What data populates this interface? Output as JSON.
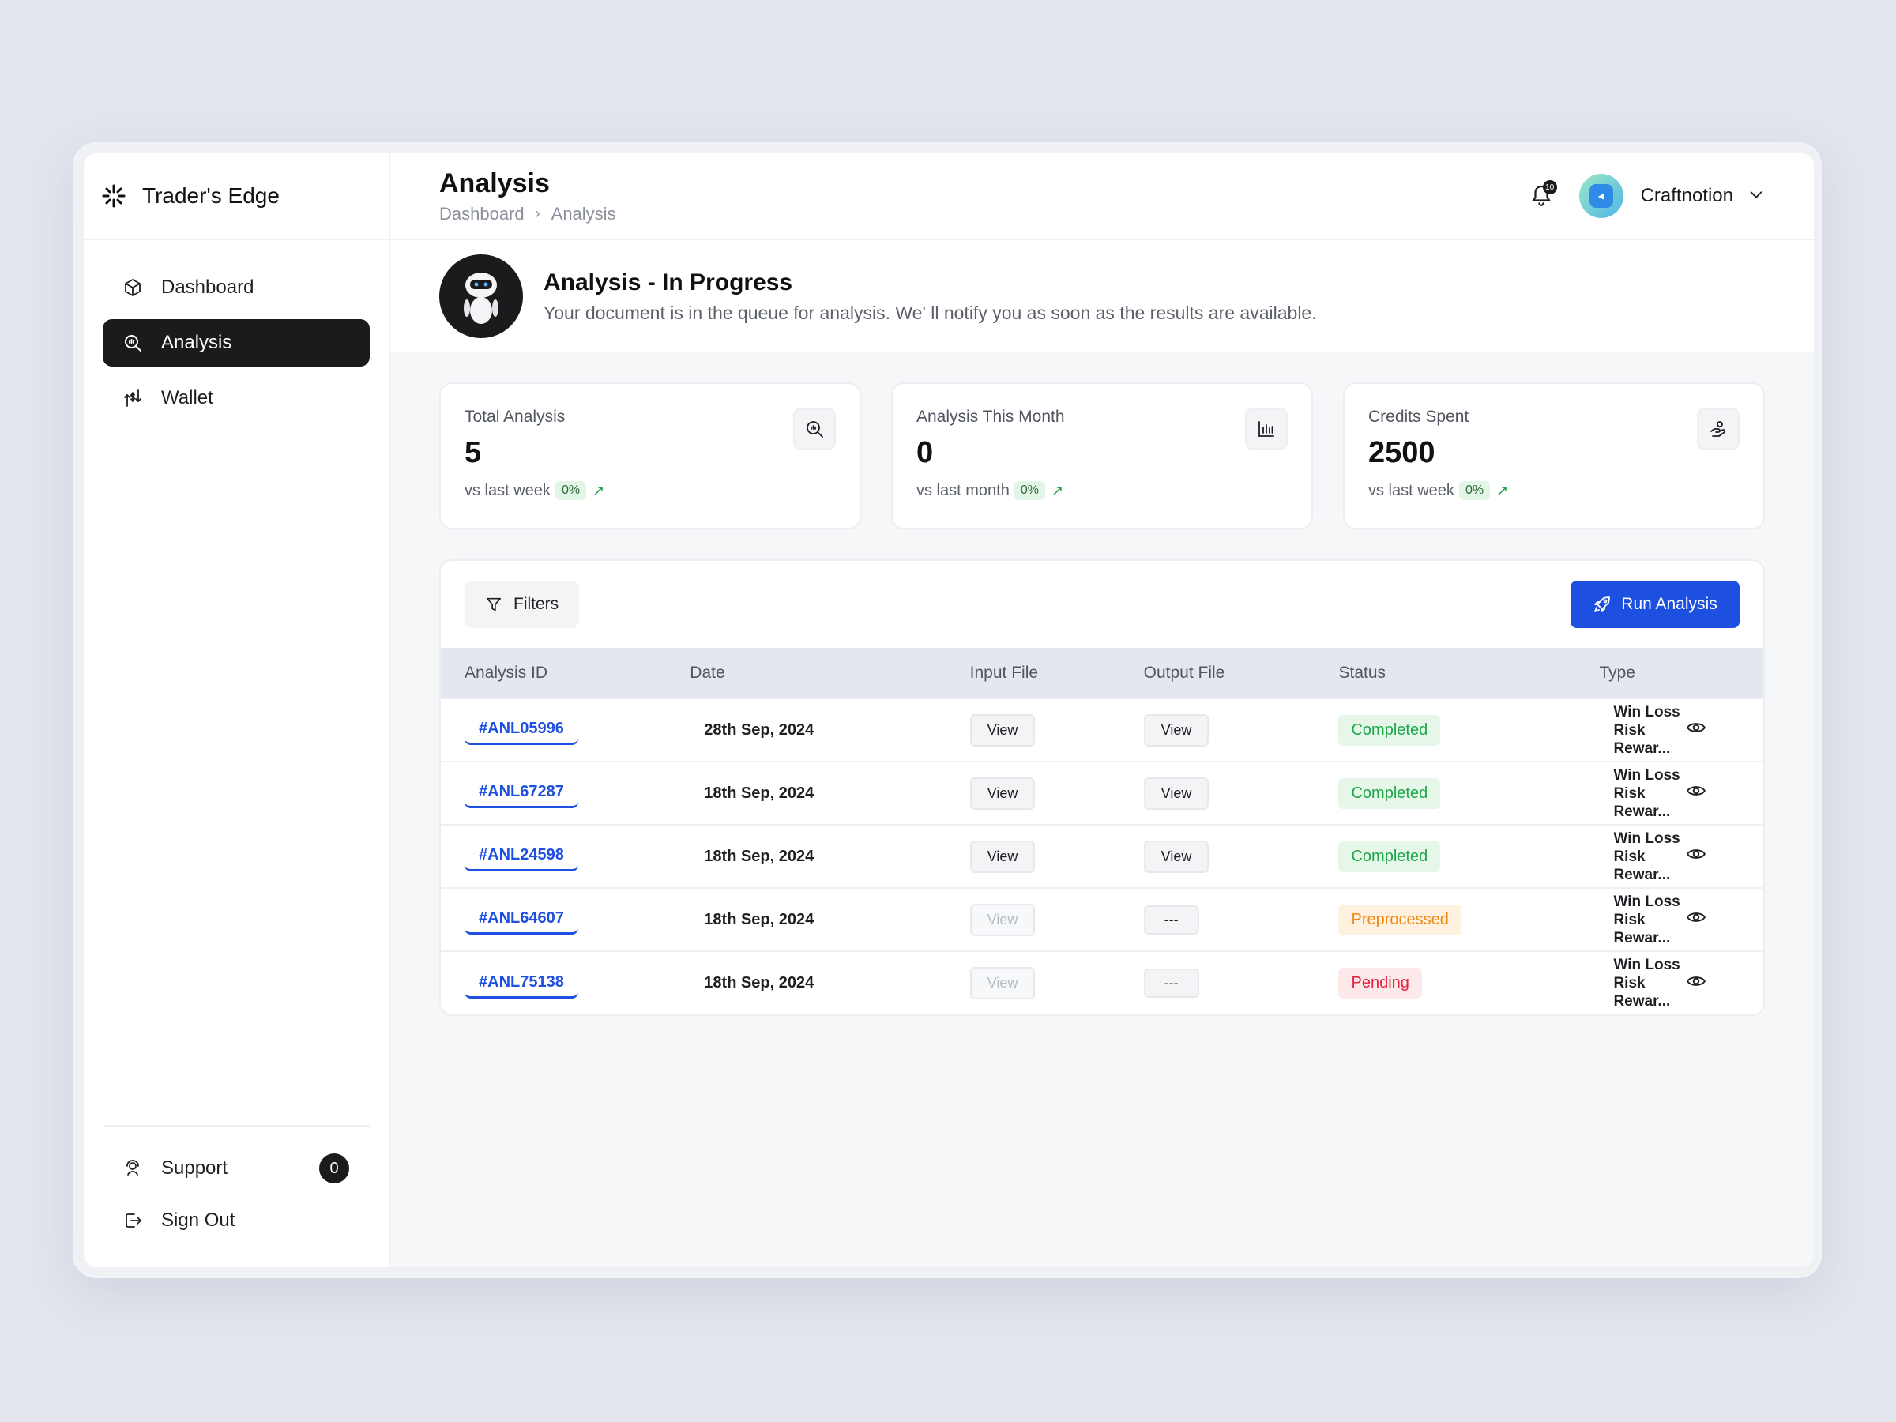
{
  "brand": {
    "name": "Trader's Edge",
    "icon": "sparkle-logo-icon"
  },
  "sidebar": {
    "items": [
      {
        "label": "Dashboard",
        "icon": "cube-icon",
        "active": false
      },
      {
        "label": "Analysis",
        "icon": "search-analysis-icon",
        "active": true
      },
      {
        "label": "Wallet",
        "icon": "wallet-transfer-icon",
        "active": false
      }
    ],
    "bottom": [
      {
        "label": "Support",
        "icon": "support-icon",
        "badge": "0"
      },
      {
        "label": "Sign Out",
        "icon": "sign-out-icon"
      }
    ]
  },
  "header": {
    "title": "Analysis",
    "breadcrumb": [
      "Dashboard",
      "Analysis"
    ],
    "notifications_count": "10",
    "user_name": "Craftnotion"
  },
  "banner": {
    "title": "Analysis - In Progress",
    "text": "Your document is in the queue for analysis. We' ll notify you as soon as the results are available."
  },
  "cards": [
    {
      "label": "Total Analysis",
      "value": "5",
      "foot": "vs last week",
      "pct": "0%",
      "icon": "search-chart-icon"
    },
    {
      "label": "Analysis This Month",
      "value": "0",
      "foot": "vs last month",
      "pct": "0%",
      "icon": "bar-chart-icon"
    },
    {
      "label": "Credits Spent",
      "value": "2500",
      "foot": "vs last week",
      "pct": "0%",
      "icon": "hand-coin-icon"
    }
  ],
  "table": {
    "filters_label": "Filters",
    "run_label": "Run Analysis",
    "columns": [
      "Analysis ID",
      "Date",
      "Input File",
      "Output File",
      "Status",
      "Type"
    ],
    "rows": [
      {
        "id": "#ANL05996",
        "date": "28th Sep, 2024",
        "input": "View",
        "input_enabled": true,
        "output": "View",
        "status": "Completed",
        "status_kind": "completed",
        "type": "Win Loss Risk Rewar..."
      },
      {
        "id": "#ANL67287",
        "date": "18th Sep, 2024",
        "input": "View",
        "input_enabled": true,
        "output": "View",
        "status": "Completed",
        "status_kind": "completed",
        "type": "Win Loss Risk Rewar..."
      },
      {
        "id": "#ANL24598",
        "date": "18th Sep, 2024",
        "input": "View",
        "input_enabled": true,
        "output": "View",
        "status": "Completed",
        "status_kind": "completed",
        "type": "Win Loss Risk Rewar..."
      },
      {
        "id": "#ANL64607",
        "date": "18th Sep, 2024",
        "input": "View",
        "input_enabled": false,
        "output": "---",
        "status": "Preprocessed",
        "status_kind": "preprocessed",
        "type": "Win Loss Risk Rewar..."
      },
      {
        "id": "#ANL75138",
        "date": "18th Sep, 2024",
        "input": "View",
        "input_enabled": false,
        "output": "---",
        "status": "Pending",
        "status_kind": "pending",
        "type": "Win Loss Risk Rewar..."
      }
    ]
  },
  "colors": {
    "accent": "#1d4fe0",
    "active_nav": "#1b1b1d",
    "completed": "#1ea84b",
    "preprocessed": "#ef8a12",
    "pending": "#e5213c"
  }
}
